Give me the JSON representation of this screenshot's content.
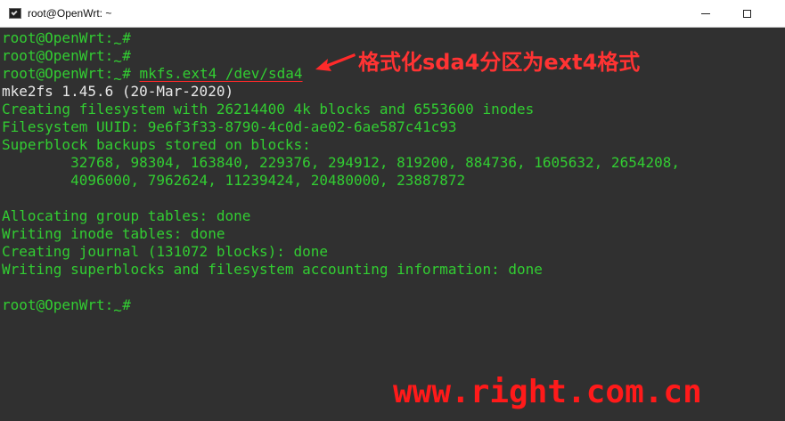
{
  "window": {
    "title": "root@OpenWrt: ~"
  },
  "terminal": {
    "prompt_user": "root@OpenWrt:",
    "prompt_tilde": "~",
    "prompt_hash": "#",
    "command": "mkfs.ext4 /dev/sda4",
    "lines": [
      "mke2fs 1.45.6 (20-Mar-2020)",
      "Creating filesystem with 26214400 4k blocks and 6553600 inodes",
      "Filesystem UUID: 9e6f3f33-8790-4c0d-ae02-6ae587c41c93",
      "Superblock backups stored on blocks:",
      "        32768, 98304, 163840, 229376, 294912, 819200, 884736, 1605632, 2654208,",
      "        4096000, 7962624, 11239424, 20480000, 23887872",
      "Allocating group tables: done",
      "Writing inode tables: done",
      "Creating journal (131072 blocks): done",
      "Writing superblocks and filesystem accounting information: done"
    ]
  },
  "annotation": {
    "text": "格式化sda4分区为ext4格式",
    "color": "#ff3333"
  },
  "watermark": {
    "text": "www.right.com.cn",
    "color": "#ff1a1a"
  }
}
